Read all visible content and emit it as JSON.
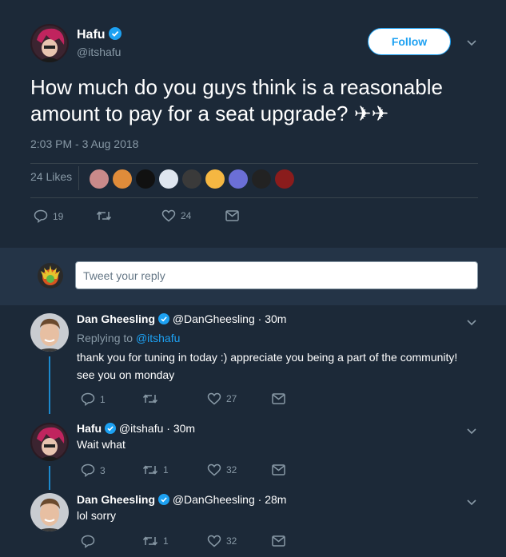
{
  "main": {
    "name": "Hafu",
    "handle": "@itshafu",
    "follow_label": "Follow",
    "text": "How much do you guys think is a reasonable amount to pay for a seat upgrade? ✈✈",
    "timestamp": "2:03 PM - 3 Aug 2018",
    "likes_label": "24 Likes",
    "actions": {
      "replies": "19",
      "retweets": "",
      "likes": "24"
    }
  },
  "reply_box": {
    "placeholder": "Tweet your reply"
  },
  "replies": [
    {
      "name": "Dan Gheesling",
      "handle": "@DanGheesling",
      "time": "· 30m",
      "replying_prefix": "Replying to ",
      "replying_to": "@itshafu",
      "text": "thank you for tuning in today :) appreciate you being a part of the community! see you on monday",
      "actions": {
        "replies": "1",
        "retweets": "",
        "likes": "27"
      }
    },
    {
      "name": "Hafu",
      "handle": "@itshafu",
      "time": "· 30m",
      "text": "Wait what",
      "actions": {
        "replies": "3",
        "retweets": "1",
        "likes": "32"
      }
    },
    {
      "name": "Dan Gheesling",
      "handle": "@DanGheesling",
      "time": "· 28m",
      "text": "lol sorry",
      "actions": {
        "replies": "",
        "retweets": "1",
        "likes": "32"
      }
    }
  ],
  "colors": {
    "background": "#1c2938",
    "reply_bar": "#243447",
    "accent": "#1da1f2",
    "muted": "#8899a6"
  }
}
